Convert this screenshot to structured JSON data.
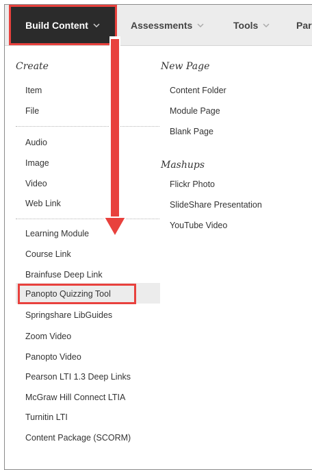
{
  "tabs": {
    "build_content": "Build Content",
    "assessments": "Assessments",
    "tools": "Tools",
    "partial": "Par"
  },
  "menu": {
    "create_heading": "Create",
    "create_group1": [
      "Item",
      "File"
    ],
    "create_group2": [
      "Audio",
      "Image",
      "Video",
      "Web Link"
    ],
    "create_group3": [
      "Learning Module",
      "Course Link",
      "Brainfuse Deep Link",
      "Panopto Quizzing Tool",
      "Springshare LibGuides",
      "Zoom Video",
      "Panopto Video",
      "Pearson LTI 1.3 Deep Links",
      "McGraw Hill Connect LTIA",
      "Turnitin LTI",
      "Content Package (SCORM)"
    ],
    "new_page_heading": "New Page",
    "new_page_items": [
      "Content Folder",
      "Module Page",
      "Blank Page"
    ],
    "mashups_heading": "Mashups",
    "mashups_items": [
      "Flickr Photo",
      "SlideShare Presentation",
      "YouTube Video"
    ]
  },
  "colors": {
    "accent_red": "#e8413d",
    "tab_active_bg": "#2b2b2b",
    "tabbar_bg": "#ececec"
  }
}
